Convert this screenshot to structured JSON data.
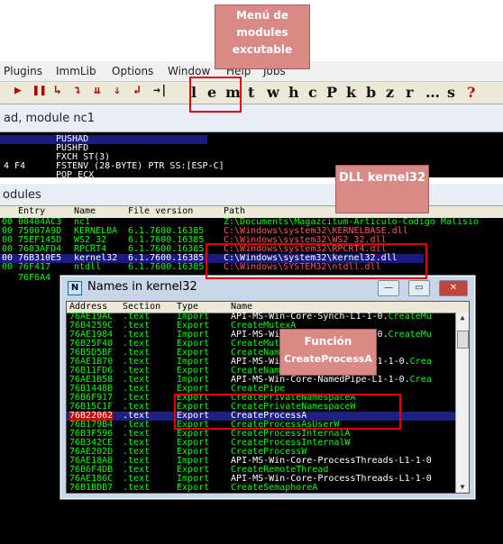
{
  "menubar": {
    "items": [
      "Plugins",
      "ImmLib",
      "Options",
      "Window",
      "Help",
      "Jobs"
    ]
  },
  "toolbar": {
    "buttons": [
      "▶",
      "❚❚",
      "↳",
      "↴",
      "⇊",
      "⇓",
      "↲",
      "→|"
    ],
    "letters": [
      "l",
      "e",
      "m",
      "t",
      "w",
      "h",
      "c",
      "P",
      "k",
      "b",
      "z",
      "r",
      "…",
      "s",
      "?"
    ]
  },
  "cpu": {
    "title": "ad, module nc1"
  },
  "disasm": {
    "rows": [
      {
        "addr": "",
        "hex": "",
        "instr": "PUSHAD",
        "color": "#ffffff"
      },
      {
        "addr": "",
        "hex": "",
        "instr": "PUSHFD",
        "color": "#ffffff"
      },
      {
        "addr": "",
        "hex": "",
        "instr": "FXCH ST(3)",
        "color": "#ffffff"
      },
      {
        "addr": "4 F4",
        "hex": "",
        "instr": "FSTENV (28-BYTE) PTR SS:[ESP-C]",
        "color": "#ffffff"
      },
      {
        "addr": "",
        "hex": "",
        "instr": "POP ECX",
        "color": "#ffffff"
      }
    ]
  },
  "modules": {
    "title": "odules",
    "columns": [
      "Entry",
      "Name",
      "File version",
      "Path"
    ],
    "rows": [
      {
        "base": "00",
        "entry": "00404AC3",
        "name": "nc1",
        "version": "",
        "path": "Z:\\Documents\\Magazcitum-Articulo-Codigo Malisio"
      },
      {
        "base": "00",
        "entry": "75007A9D",
        "name": "KERNELBA",
        "version": "6.1.7600.16385",
        "path": "C:\\Windows\\system32\\KERNELBASE.dll"
      },
      {
        "base": "00",
        "entry": "75EF145D",
        "name": "WS2_32",
        "version": "6.1.7600.16385",
        "path": "C:\\Windows\\system32\\WS2_32.dll"
      },
      {
        "base": "00",
        "entry": "7603AFD4",
        "name": "RPCRT4",
        "version": "6.1.7600.16385",
        "path": "C:\\Windows\\system32\\RPCRT4.dll"
      },
      {
        "base": "00",
        "entry": "76B310E5",
        "name": "kernel32",
        "version": "6.1.7600.16385",
        "path": "C:\\Windows\\system32\\kernel32.dll",
        "selected": true
      },
      {
        "base": "00",
        "entry": "76F417",
        "name": "ntdll",
        "version": "6.1.7600.16385",
        "path": "C:\\Windows\\SYSTEM32\\ntdll.dll"
      },
      {
        "base": "00",
        "entry": "76F6A4",
        "name": "",
        "version": "",
        "path": ""
      }
    ]
  },
  "names_dialog": {
    "title": "Names in kernel32",
    "icon_letter": "N",
    "columns": [
      "Address",
      "Section",
      "Type",
      "Name"
    ],
    "rows": [
      {
        "addr": "76AE19AC",
        "sec": ".text",
        "type": "Import",
        "name": "API-MS-Win-Core-Synch-L1-1-0.",
        "name2": "CreateMu"
      },
      {
        "addr": "76B4259C",
        "sec": ".text",
        "type": "Export",
        "name": "CreateMutexA",
        "name2": ""
      },
      {
        "addr": "76AE1984",
        "sec": ".text",
        "type": "Import",
        "name": "API-MS-Win-Core-Synch-L1-1-0.",
        "name2": "CreateMu"
      },
      {
        "addr": "76B25F40",
        "sec": ".text",
        "type": "Export",
        "name": "CreateMutexW",
        "name2": ""
      },
      {
        "addr": "76B5D5BF",
        "sec": ".text",
        "type": "Export",
        "name": "CreateNamedPipeA",
        "name2": ""
      },
      {
        "addr": "76AE1B70",
        "sec": ".text",
        "type": "Import",
        "name": "API-MS-Win-Core-NamedPipe-L1-1-0.",
        "name2": "Crea"
      },
      {
        "addr": "76B11FD6",
        "sec": ".text",
        "type": "Export",
        "name": "CreateNamedPipeW",
        "name2": ""
      },
      {
        "addr": "76AE1B58",
        "sec": ".text",
        "type": "Import",
        "name": "API-MS-Win-Core-NamedPipe-L1-1-0.",
        "name2": "Crea"
      },
      {
        "addr": "76B1448B",
        "sec": ".text",
        "type": "Export",
        "name": "CreatePipe",
        "name2": ""
      },
      {
        "addr": "76B6F917",
        "sec": ".text",
        "type": "Export",
        "name": "CreatePrivateNamespaceA",
        "name2": ""
      },
      {
        "addr": "76B15C1F",
        "sec": ".text",
        "type": "Export",
        "name": "CreatePrivateNamespaceW",
        "name2": ""
      },
      {
        "addr": "76B22062",
        "sec": ".text",
        "type": "Export",
        "name": "CreateProcessA",
        "name2": "",
        "selected": true
      },
      {
        "addr": "76B179B4",
        "sec": ".text",
        "type": "Export",
        "name": "CreateProcessAsUserW",
        "name2": ""
      },
      {
        "addr": "76B3F596",
        "sec": ".text",
        "type": "Export",
        "name": "CreateProcessInternalA",
        "name2": ""
      },
      {
        "addr": "76B342CE",
        "sec": ".text",
        "type": "Export",
        "name": "CreateProcessInternalW",
        "name2": ""
      },
      {
        "addr": "76AE202D",
        "sec": ".text",
        "type": "Export",
        "name": "CreateProcessW",
        "name2": ""
      },
      {
        "addr": "76AE18A8",
        "sec": ".text",
        "type": "Import",
        "name": "API-MS-Win-Core-ProcessThreads-L1-1-0",
        "name2": ""
      },
      {
        "addr": "76B6F4DB",
        "sec": ".text",
        "type": "Export",
        "name": "CreateRemoteThread",
        "name2": ""
      },
      {
        "addr": "76AE186C",
        "sec": ".text",
        "type": "Import",
        "name": "API-MS-Win-Core-ProcessThreads-L1-1-0",
        "name2": ""
      },
      {
        "addr": "76B1BDB7",
        "sec": ".text",
        "type": "Export",
        "name": "CreateSemaphoreA",
        "name2": ""
      }
    ]
  },
  "annotations": {
    "menu": "Menú de modules excutable",
    "dll": "DLL kernel32",
    "func_title": "Función",
    "func_name": "CreateProcessA"
  },
  "colors": {
    "callout": "#d98a86",
    "highlight_box": "#e00000",
    "list_bg": "#000000",
    "list_text": "#00ff00"
  },
  "icons": [
    "play-icon",
    "pause-icon",
    "step-into-icon",
    "step-over-icon",
    "trace-icon",
    "minimize-icon",
    "maximize-icon",
    "close-icon"
  ]
}
